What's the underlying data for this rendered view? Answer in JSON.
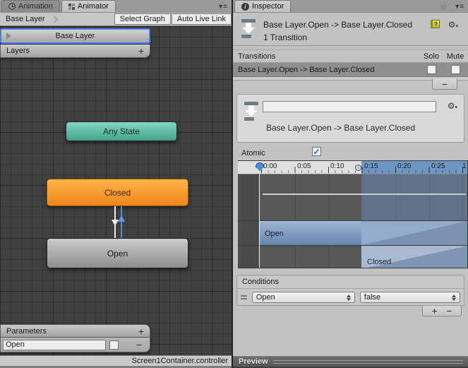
{
  "animator": {
    "tabs": {
      "animation": "Animation",
      "animator": "Animator"
    },
    "pane_menu": "▾≡",
    "breadcrumb": "Base Layer",
    "select_graph": "Select Graph",
    "auto_live_link": "Auto Live Link",
    "layer_item": "Base Layer",
    "layers_header": "Layers",
    "layers_add": "+",
    "nodes": {
      "any_state": "Any State",
      "closed": "Closed",
      "open": "Open"
    },
    "parameters": {
      "header": "Parameters",
      "add": "+",
      "name": "Open",
      "remove": "−"
    },
    "status": "Screen1Container.controller"
  },
  "inspector": {
    "tab": "Inspector",
    "info_glyph": "i",
    "pane_menu": "▾≡",
    "title": "Base Layer.Open -> Base Layer.Closed",
    "subtitle": "1 Transition",
    "help_glyph": "?",
    "gear_glyph": "⚙",
    "transitions": {
      "header": "Transitions",
      "solo": "Solo",
      "mute": "Mute",
      "row": "Base Layer.Open -> Base Layer.Closed",
      "remove": "−"
    },
    "detail": {
      "name": "",
      "label": "Base Layer.Open -> Base Layer.Closed"
    },
    "atomic": "Atomic",
    "atomic_check": "✓",
    "timeline": {
      "ticks": [
        "0:00",
        "0:05",
        "0:10",
        "0:15",
        "0:20",
        "0:25",
        "1"
      ],
      "open": "Open",
      "closed": "Closed"
    },
    "conditions": {
      "header": "Conditions",
      "param": "Open",
      "value": "false",
      "add": "+",
      "remove": "−"
    },
    "preview": "Preview"
  },
  "colors": {
    "selection_blue": "#4C7EFA",
    "node_teal": "#5FBFA8",
    "node_orange": "#F79420",
    "timeline_blue": "#6E96C4"
  }
}
